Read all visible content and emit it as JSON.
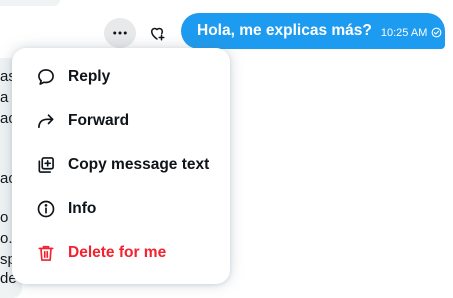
{
  "message": {
    "text": "Hola, me explicas más?",
    "time": "10:25 AM"
  },
  "left_fragments": [
    "as",
    "a l",
    "ac",
    "ac",
    "o",
    "o.",
    "sp",
    "de"
  ],
  "menu": {
    "items": [
      {
        "label": "Reply",
        "icon": "reply-bubble-icon"
      },
      {
        "label": "Forward",
        "icon": "forward-arrow-icon"
      },
      {
        "label": "Copy message text",
        "icon": "copy-icon"
      },
      {
        "label": "Info",
        "icon": "info-icon"
      },
      {
        "label": "Delete for me",
        "icon": "trash-icon"
      }
    ]
  },
  "colors": {
    "accent": "#1d9bf0",
    "danger": "#f4212e",
    "text": "#0f1419",
    "hover_bg": "#e7e9ea"
  }
}
